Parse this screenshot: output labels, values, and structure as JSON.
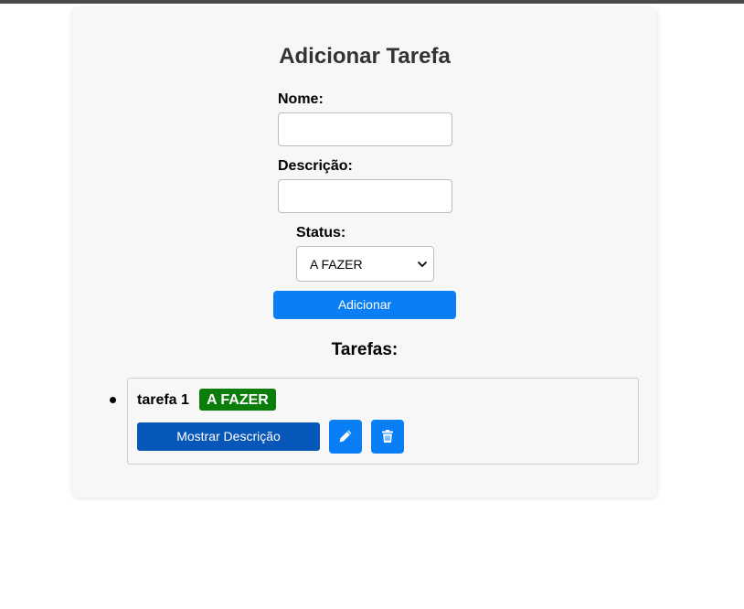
{
  "form": {
    "title": "Adicionar Tarefa",
    "name_label": "Nome:",
    "name_value": "",
    "description_label": "Descrição:",
    "description_value": "",
    "status_label": "Status:",
    "status_selected": "A FAZER",
    "submit_label": "Adicionar"
  },
  "tasks": {
    "heading": "Tarefas:",
    "items": [
      {
        "name": "tarefa 1",
        "status": "A FAZER",
        "show_description_label": "Mostrar Descrição",
        "edit_icon": "pencil-icon",
        "delete_icon": "trash-icon"
      }
    ]
  },
  "colors": {
    "primary": "#0a7ff5",
    "secondary_button": "#0757b8",
    "status_todo": "#0a7d0a",
    "card_background": "#f7f7f7"
  }
}
